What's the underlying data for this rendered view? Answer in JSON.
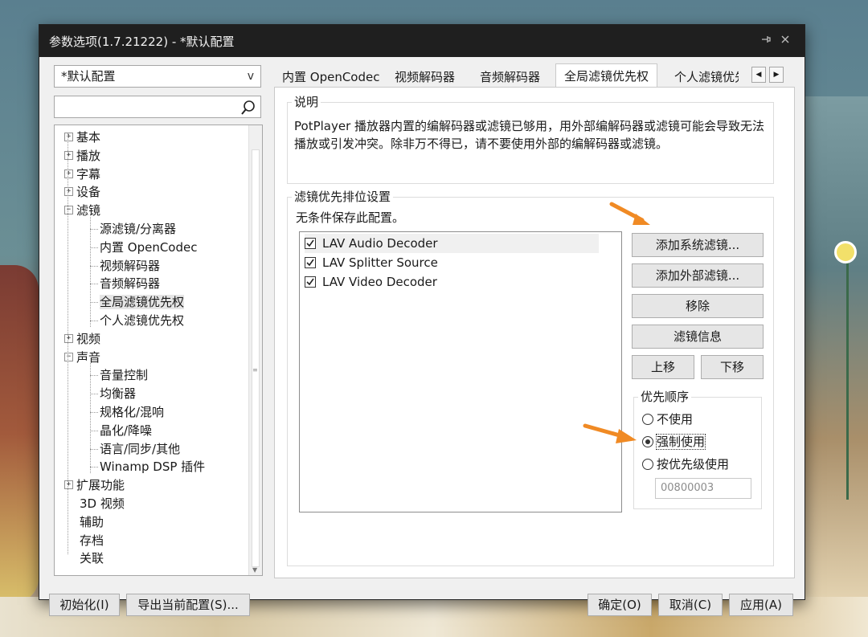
{
  "window": {
    "title": "参数选项(1.7.21222) - *默认配置",
    "pin_icon": "pin-icon",
    "close_icon": "close-icon"
  },
  "left": {
    "preset": "*默认配置",
    "preset_arrow": "v",
    "search_placeholder": "",
    "tree": [
      {
        "label": "基本",
        "expander": "+"
      },
      {
        "label": "播放",
        "expander": "+"
      },
      {
        "label": "字幕",
        "expander": "+"
      },
      {
        "label": "设备",
        "expander": "+"
      },
      {
        "label": "滤镜",
        "expander": "−"
      },
      {
        "label": "源滤镜/分离器"
      },
      {
        "label": "内置 OpenCodec"
      },
      {
        "label": "视频解码器"
      },
      {
        "label": "音频解码器"
      },
      {
        "label": "全局滤镜优先权",
        "selected": true
      },
      {
        "label": "个人滤镜优先权"
      },
      {
        "label": "视频",
        "expander": "+"
      },
      {
        "label": "声音",
        "expander": "−"
      },
      {
        "label": "音量控制"
      },
      {
        "label": "均衡器"
      },
      {
        "label": "规格化/混响"
      },
      {
        "label": "晶化/降噪"
      },
      {
        "label": "语言/同步/其他"
      },
      {
        "label": "Winamp DSP 插件"
      },
      {
        "label": "扩展功能",
        "expander": "+"
      },
      {
        "label": "3D 视频"
      },
      {
        "label": "辅助"
      },
      {
        "label": "存档"
      },
      {
        "label": "关联"
      }
    ]
  },
  "tabs": [
    {
      "label": "内置 OpenCodec"
    },
    {
      "label": "视频解码器"
    },
    {
      "label": "音频解码器"
    },
    {
      "label": "全局滤镜优先权",
      "active": true
    },
    {
      "label": "个人滤镜优先"
    }
  ],
  "description": {
    "title": "说明",
    "text": "PotPlayer 播放器内置的编解码器或滤镜已够用，用外部编解码器或滤镜可能会导致无法播放或引发冲突。除非万不得已，请不要使用外部的编解码器或滤镜。"
  },
  "priority": {
    "title": "滤镜优先排位设置",
    "note": "无条件保存此配置。",
    "filters": [
      {
        "label": "LAV Audio Decoder",
        "checked": true
      },
      {
        "label": "LAV Splitter Source",
        "checked": true
      },
      {
        "label": "LAV Video Decoder",
        "checked": true
      }
    ],
    "buttons": {
      "add_system": "添加系统滤镜...",
      "add_external": "添加外部滤镜...",
      "remove": "移除",
      "info": "滤镜信息",
      "up": "上移",
      "down": "下移"
    },
    "order": {
      "title": "优先顺序",
      "options": [
        {
          "label": "不使用",
          "selected": false
        },
        {
          "label": "强制使用",
          "selected": true
        },
        {
          "label": "按优先级使用",
          "selected": false
        }
      ],
      "value": "00800003"
    }
  },
  "footer": {
    "reset": "初始化(I)",
    "export": "导出当前配置(S)...",
    "ok": "确定(O)",
    "cancel": "取消(C)",
    "apply": "应用(A)"
  },
  "colors": {
    "annotation_arrow": "#f08a24",
    "titlebar": "#1f1f1f"
  }
}
